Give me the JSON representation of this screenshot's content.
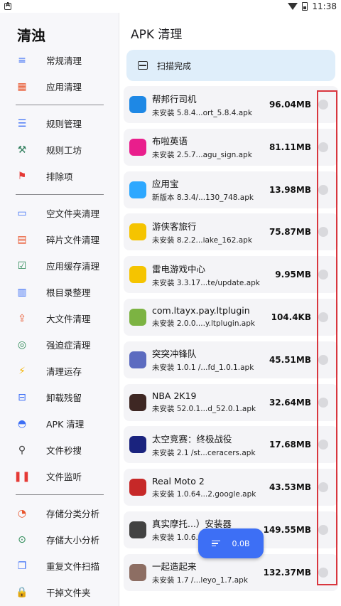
{
  "status_bar": {
    "time": "11:38"
  },
  "sidebar": {
    "title": "清浊",
    "groups": [
      [
        {
          "label": "常规清理",
          "icon": "lines-icon",
          "color": "#3d6ff5"
        },
        {
          "label": "应用清理",
          "icon": "grid-icon",
          "color": "#e8542b"
        }
      ],
      [
        {
          "label": "规则管理",
          "icon": "list-icon",
          "color": "#3d6ff5"
        },
        {
          "label": "规则工坊",
          "icon": "magic-wand-icon",
          "color": "#2e7d5b"
        },
        {
          "label": "排除项",
          "icon": "flag-icon",
          "color": "#e53935"
        }
      ],
      [
        {
          "label": "空文件夹清理",
          "icon": "folder-icon",
          "color": "#3d6ff5"
        },
        {
          "label": "碎片文件清理",
          "icon": "document-icon",
          "color": "#e8542b"
        },
        {
          "label": "应用缓存清理",
          "icon": "checklist-icon",
          "color": "#2e8b57"
        },
        {
          "label": "根目录整理",
          "icon": "columns-icon",
          "color": "#3d6ff5"
        },
        {
          "label": "大文件清理",
          "icon": "upload-box-icon",
          "color": "#e8542b"
        },
        {
          "label": "强迫症清理",
          "icon": "target-icon",
          "color": "#2e8b57"
        },
        {
          "label": "清理运存",
          "icon": "lightning-icon",
          "color": "#f5b400"
        },
        {
          "label": "卸载残留",
          "icon": "uninstall-icon",
          "color": "#3d6ff5"
        },
        {
          "label": "APK 清理",
          "icon": "android-icon",
          "color": "#3d6ff5"
        },
        {
          "label": "文件秒搜",
          "icon": "search-icon",
          "color": "#3d3d3d"
        },
        {
          "label": "文件监听",
          "icon": "pause-icon",
          "color": "#e53935"
        }
      ],
      [
        {
          "label": "存储分类分析",
          "icon": "pie-chart-icon",
          "color": "#e8542b"
        },
        {
          "label": "存储大小分析",
          "icon": "dots-circle-icon",
          "color": "#2e8b57"
        },
        {
          "label": "重复文件扫描",
          "icon": "copy-icon",
          "color": "#3d6ff5"
        },
        {
          "label": "干掉文件夹",
          "icon": "lock-icon",
          "color": "#e8542b"
        }
      ]
    ]
  },
  "main": {
    "title": "APK 清理",
    "banner": "扫描完成",
    "apps": [
      {
        "name": "帮邦行司机",
        "sub": "未安装 5.8.4...ort_5.8.4.apk",
        "size": "96.04MB",
        "icon": "bangbang-icon",
        "color": "#1e88e5"
      },
      {
        "name": "布啦英语",
        "sub": "未安装 2.5.7...agu_sign.apk",
        "size": "81.11MB",
        "icon": "bula-icon",
        "color": "#e91e8c"
      },
      {
        "name": "应用宝",
        "sub": "新版本 8.3.4/...130_748.apk",
        "size": "13.98MB",
        "icon": "yingyongbao-icon",
        "color": "#2ea8ff"
      },
      {
        "name": "游侠客旅行",
        "sub": "未安装 8.2.2...iake_162.apk",
        "size": "75.87MB",
        "icon": "youxiake-icon",
        "color": "#f5c400"
      },
      {
        "name": "雷电游戏中心",
        "sub": "未安装 3.3.17...te/update.apk",
        "size": "9.95MB",
        "icon": "gamepad-icon",
        "color": "#f5c400"
      },
      {
        "name": "com.ltayx.pay.ltplugin",
        "sub": "未安装 2.0.0....y.ltplugin.apk",
        "size": "104.4KB",
        "icon": "android-icon",
        "color": "#7cb342"
      },
      {
        "name": "突突冲锋队",
        "sub": "未安装 1.0.1 /...fd_1.0.1.apk",
        "size": "45.51MB",
        "icon": "game-icon",
        "color": "#5c6bc0"
      },
      {
        "name": "NBA 2K19",
        "sub": "未安装 52.0.1...d_52.0.1.apk",
        "size": "32.64MB",
        "icon": "nba-icon",
        "color": "#3e2723"
      },
      {
        "name": "太空竞赛：终极战役",
        "sub": "未安装 2.1 /st...ceracers.apk",
        "size": "17.68MB",
        "icon": "space-icon",
        "color": "#1a237e"
      },
      {
        "name": "Real Moto 2",
        "sub": "未安装 1.0.64...2.google.apk",
        "size": "43.53MB",
        "icon": "moto-icon",
        "color": "#c62828"
      },
      {
        "name": "真实摩托...）安装器",
        "sub": "未安装 1.0.6...",
        "size": "149.55MB",
        "icon": "moto2-icon",
        "color": "#424242"
      },
      {
        "name": "一起造起来",
        "sub": "未安装 1.7 /...leyo_1.7.apk",
        "size": "132.37MB",
        "icon": "build-icon",
        "color": "#8d6e63"
      }
    ]
  },
  "fab": {
    "label": "0.0B"
  },
  "colors": {
    "accent": "#3d6ff5",
    "highlight": "#d9363e",
    "banner": "#dfeefa"
  }
}
